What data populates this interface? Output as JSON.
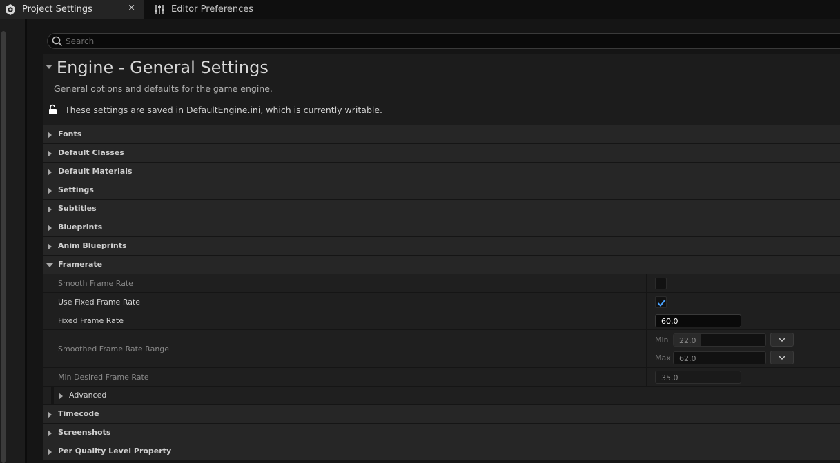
{
  "tabs": [
    {
      "label": "Project Settings",
      "icon": "project-settings-icon",
      "close": "×"
    },
    {
      "label": "Editor Preferences",
      "icon": "sliders-icon"
    }
  ],
  "search": {
    "placeholder": "Search",
    "value": ""
  },
  "header": {
    "title": "Engine - General Settings",
    "description": "General options and defaults for the game engine.",
    "saved_note": "These settings are saved in DefaultEngine.ini, which is currently writable."
  },
  "categories_before": [
    {
      "label": "Fonts"
    },
    {
      "label": "Default Classes"
    },
    {
      "label": "Default Materials"
    },
    {
      "label": "Settings"
    },
    {
      "label": "Subtitles"
    },
    {
      "label": "Blueprints"
    },
    {
      "label": "Anim Blueprints"
    }
  ],
  "framerate": {
    "label": "Framerate",
    "smooth_frame_rate": {
      "label": "Smooth Frame Rate",
      "checked": false
    },
    "use_fixed_frame_rate": {
      "label": "Use Fixed Frame Rate",
      "checked": true
    },
    "fixed_frame_rate": {
      "label": "Fixed Frame Rate",
      "value": "60.0"
    },
    "smoothed_range": {
      "label": "Smoothed Frame Rate Range",
      "min_label": "Min",
      "min_value": "22.0",
      "min_fill": 0.3,
      "max_label": "Max",
      "max_value": "62.0"
    },
    "min_desired": {
      "label": "Min Desired Frame Rate",
      "value": "35.0"
    },
    "advanced": {
      "label": "Advanced"
    }
  },
  "categories_after": [
    {
      "label": "Timecode"
    },
    {
      "label": "Screenshots"
    },
    {
      "label": "Per Quality Level Property"
    }
  ],
  "colors": {
    "accent": "#1a8cff",
    "checkbox_check": "#4aa3ff"
  }
}
